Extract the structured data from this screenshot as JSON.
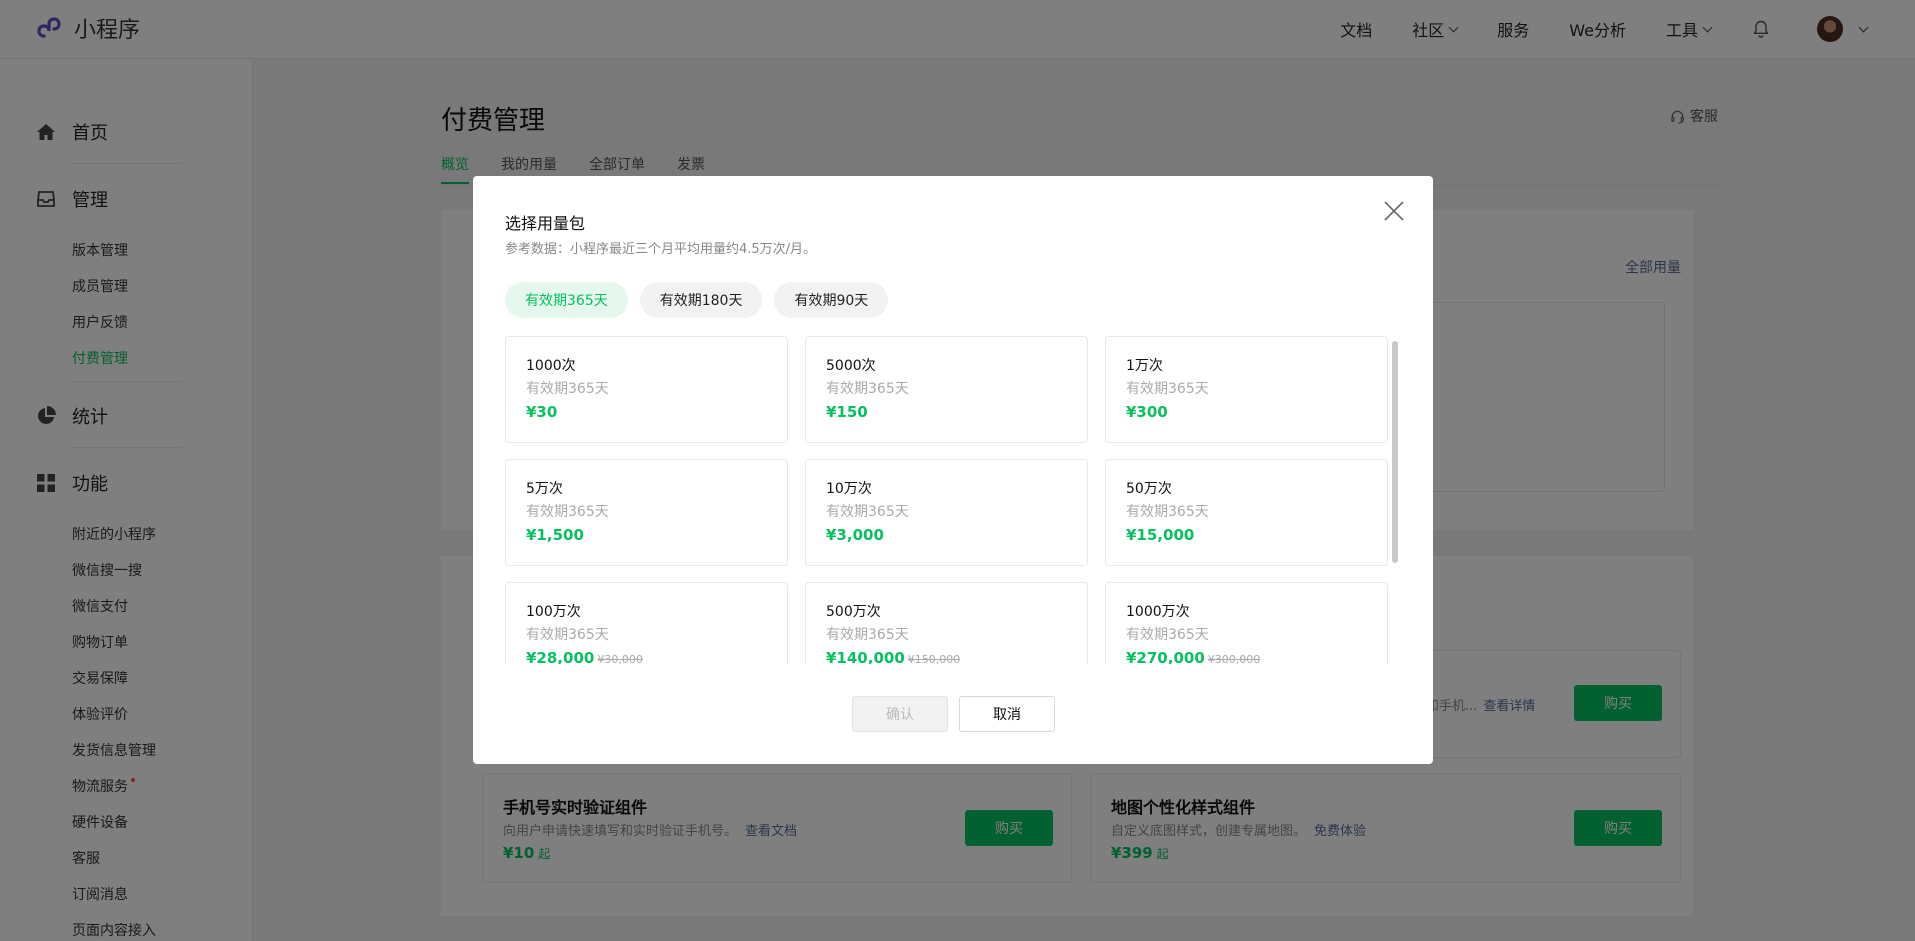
{
  "app": {
    "logo_text": "小程序"
  },
  "nav": {
    "docs": "文档",
    "community": "社区",
    "service": "服务",
    "analytics": "We分析",
    "tools": "工具"
  },
  "sidebar": {
    "home": "首页",
    "manage": "管理",
    "manage_items": [
      "版本管理",
      "成员管理",
      "用户反馈",
      "付费管理"
    ],
    "stats": "统计",
    "features": "功能",
    "feature_items": [
      "附近的小程序",
      "微信搜一搜",
      "微信支付",
      "购物订单",
      "交易保障",
      "体验评价",
      "发货信息管理",
      "物流服务",
      "硬件设备",
      "客服",
      "订阅消息",
      "页面内容接入"
    ]
  },
  "main": {
    "title": "付费管理",
    "support": "客服",
    "tabs": [
      "概览",
      "我的用量",
      "全部订单",
      "发票"
    ],
    "all_usage": "全部用量",
    "peek_desc": "和手机...",
    "peek_link": "查看详情",
    "buy_label": "购买",
    "services": [
      {
        "title": "手机号实时验证组件",
        "desc": "向用户申请快速填写和实时验证手机号。",
        "link": "查看文档",
        "price": "¥10",
        "suffix": "起"
      },
      {
        "title": "地图个性化样式组件",
        "desc": "自定义底图样式，创建专属地图。",
        "link": "免费体验",
        "price": "¥399",
        "suffix": "起"
      }
    ]
  },
  "modal": {
    "title": "选择用量包",
    "subtitle": "参考数据：小程序最近三个月平均用量约4.5万次/月。",
    "periods": [
      "有效期365天",
      "有效期180天",
      "有效期90天"
    ],
    "packages": [
      {
        "name": "1000次",
        "valid": "有效期365天",
        "price": "¥30",
        "original": ""
      },
      {
        "name": "5000次",
        "valid": "有效期365天",
        "price": "¥150",
        "original": ""
      },
      {
        "name": "1万次",
        "valid": "有效期365天",
        "price": "¥300",
        "original": ""
      },
      {
        "name": "5万次",
        "valid": "有效期365天",
        "price": "¥1,500",
        "original": ""
      },
      {
        "name": "10万次",
        "valid": "有效期365天",
        "price": "¥3,000",
        "original": ""
      },
      {
        "name": "50万次",
        "valid": "有效期365天",
        "price": "¥15,000",
        "original": ""
      },
      {
        "name": "100万次",
        "valid": "有效期365天",
        "price": "¥28,000",
        "original": "¥30,000"
      },
      {
        "name": "500万次",
        "valid": "有效期365天",
        "price": "¥140,000",
        "original": "¥150,000"
      },
      {
        "name": "1000万次",
        "valid": "有效期365天",
        "price": "¥270,000",
        "original": "¥300,000"
      }
    ],
    "confirm": "确认",
    "cancel": "取消"
  },
  "colors": {
    "accent": "#07c160",
    "link": "#576b95",
    "overlay": "rgba(0,0,0,0.5)"
  }
}
